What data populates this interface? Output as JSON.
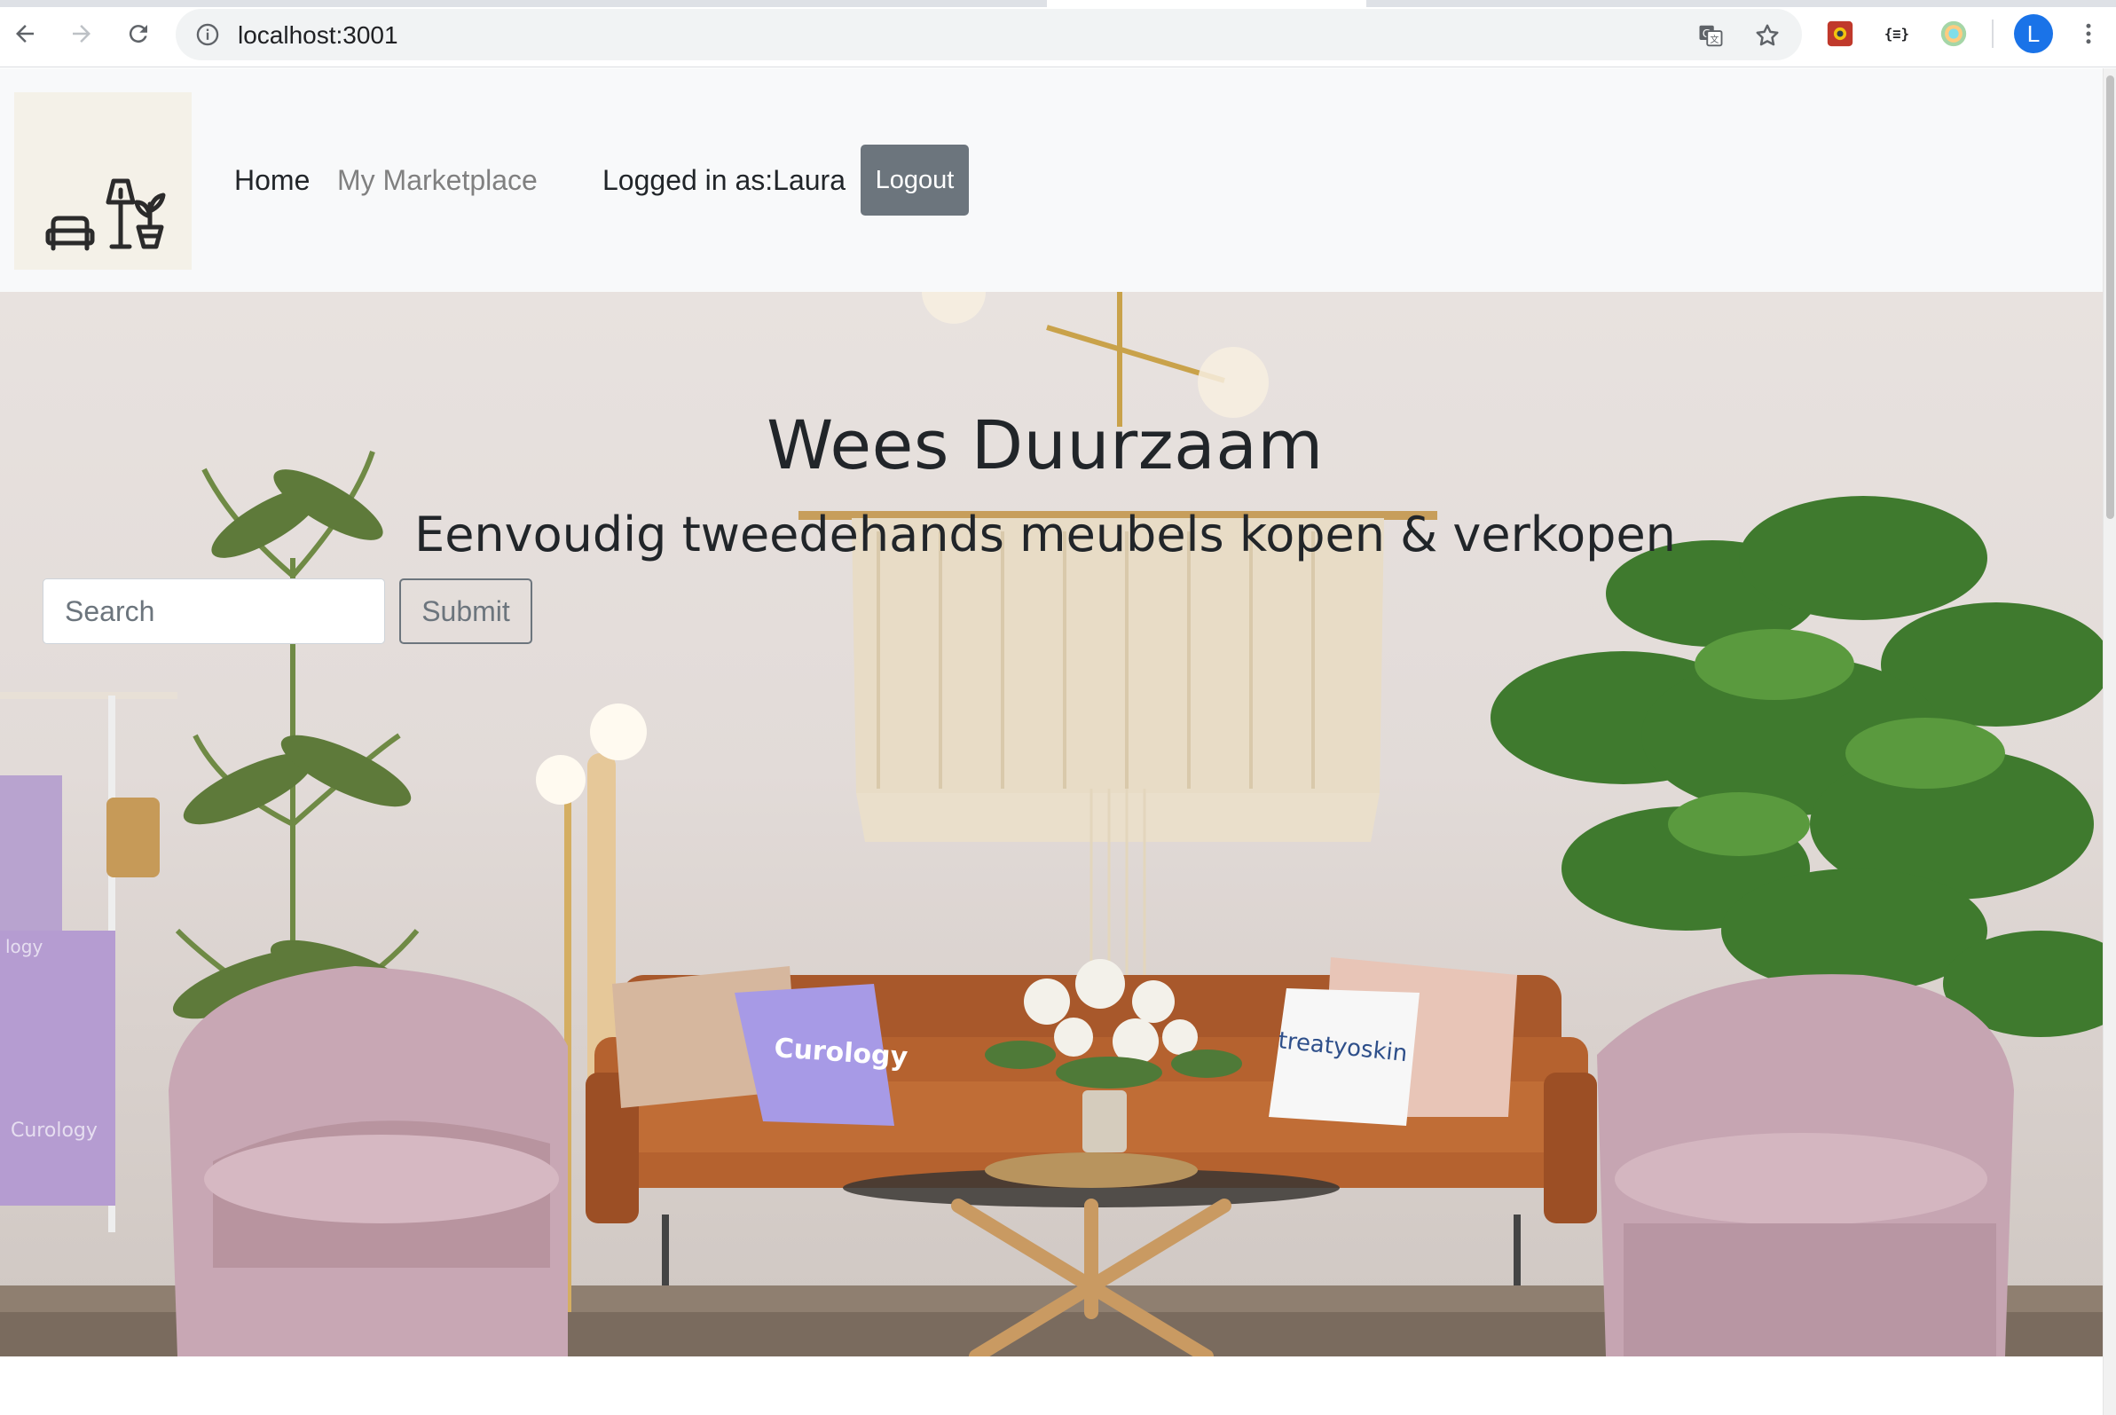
{
  "browser": {
    "url": "localhost:3001",
    "profile_initial": "L",
    "extensions": [
      "puzzle-extension-icon",
      "json-formatter-icon",
      "color-picker-icon"
    ]
  },
  "navbar": {
    "home_label": "Home",
    "marketplace_label": "My Marketplace",
    "logged_in_text": "Logged in as:Laura",
    "logout_label": "Logout"
  },
  "hero": {
    "title": "Wees Duurzaam",
    "subtitle": "Eenvoudig tweedehands meubels kopen & verkopen",
    "cushion_left_text": "Curology",
    "cushion_right_text": "treatyoskin",
    "towel_text": "Curology",
    "towel_text_top": "logy"
  },
  "search": {
    "placeholder": "Search",
    "submit_label": "Submit"
  },
  "colors": {
    "navbar_bg": "#f8f9fa",
    "logout_bg": "#6c757d",
    "text_dark": "#212529",
    "text_muted": "#808080",
    "brand_bg": "#f4f1e8"
  }
}
